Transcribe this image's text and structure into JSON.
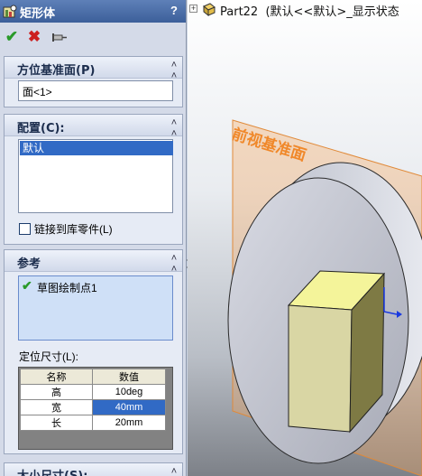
{
  "window": {
    "title": "矩形体",
    "help": "?"
  },
  "actions": {
    "ok": "✔",
    "cancel": "✖",
    "pin": "pin-icon"
  },
  "sections": {
    "orientation": {
      "title": "方位基准面(P)",
      "value": "面<1>"
    },
    "config": {
      "title": "配置(C):",
      "selected": "默认",
      "link_label": "链接到库零件(L)",
      "link_checked": false
    },
    "reference": {
      "title": "参考",
      "item": "草图绘制点1"
    },
    "locating": {
      "label": "定位尺寸(L):",
      "columns": [
        "名称",
        "数值"
      ],
      "rows": [
        {
          "name": "高",
          "value": "10deg",
          "selected": false
        },
        {
          "name": "宽",
          "value": "40mm",
          "selected": true
        },
        {
          "name": "长",
          "value": "20mm",
          "selected": false
        }
      ]
    },
    "size": {
      "title": "大小尺寸(S):"
    }
  },
  "tree": {
    "root_label": "Part22",
    "config_label": "(默认<<默认>_显示状态"
  },
  "viewport": {
    "plane_label": "前视基准面"
  },
  "colors": {
    "plane": "#f5a65b",
    "box_top": "#f4f49a",
    "box_front": "#d9d6a4",
    "cylinder": "#c8cad4",
    "accent": "#316ac5"
  }
}
